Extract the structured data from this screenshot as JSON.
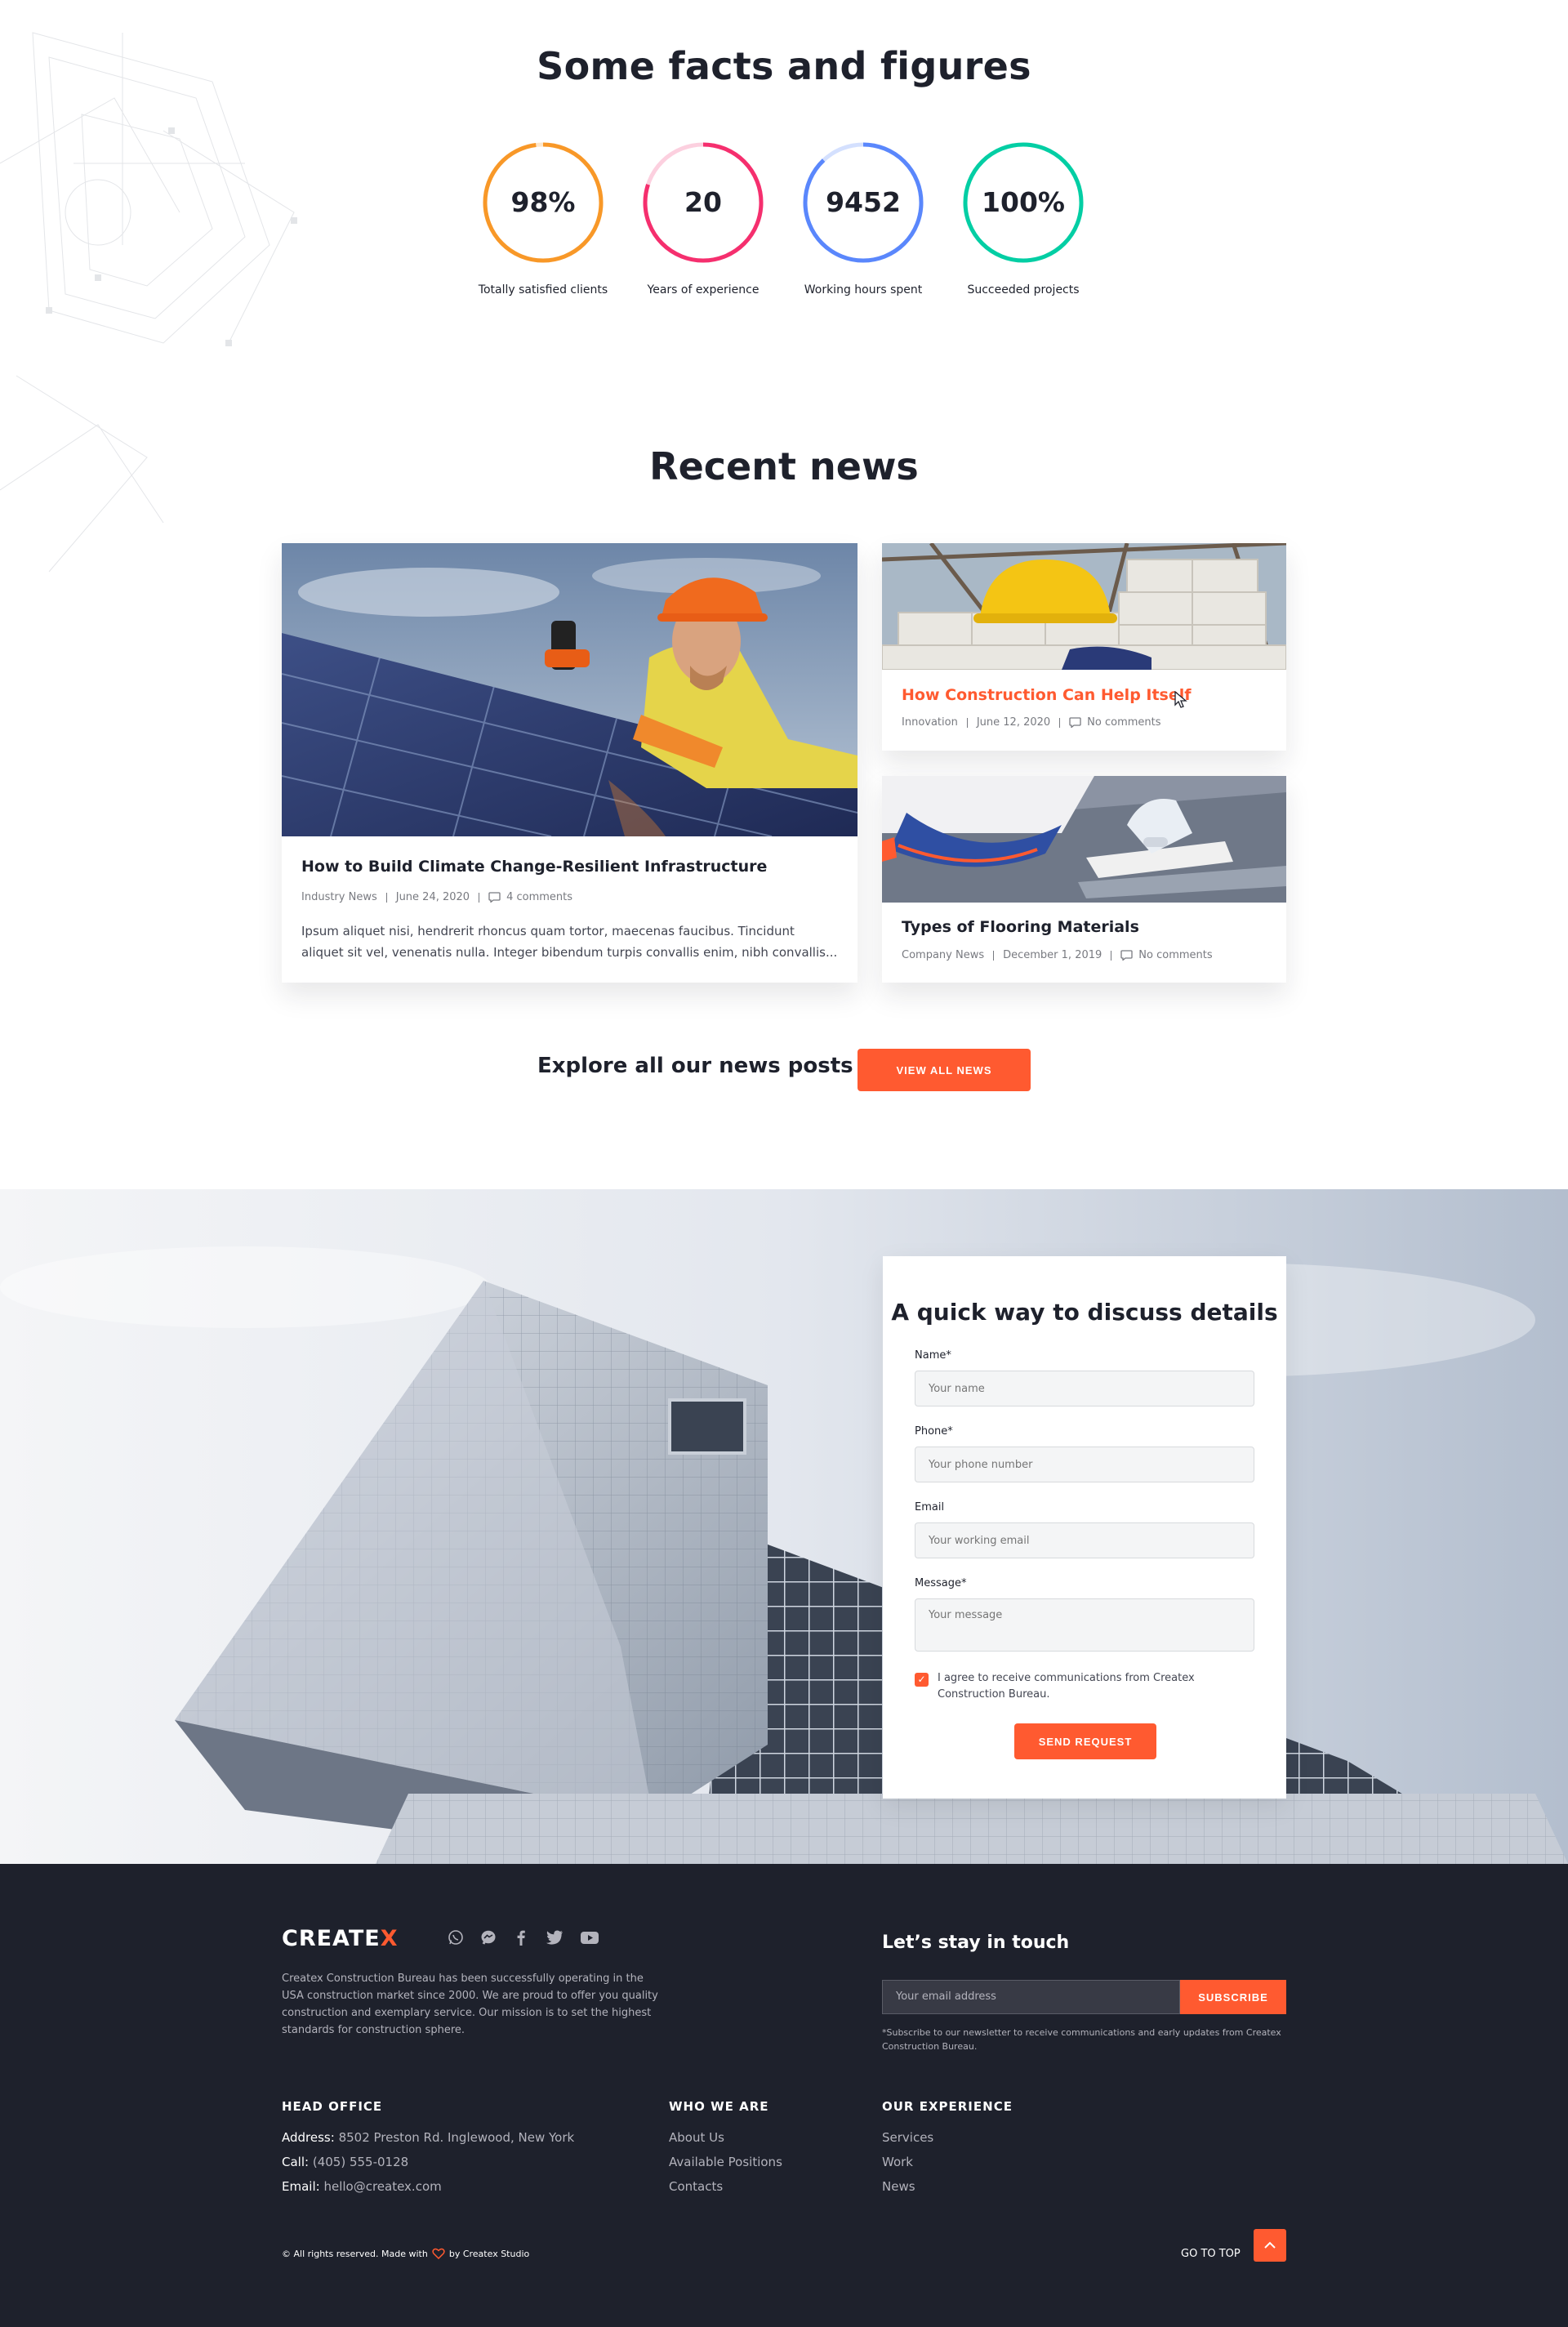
{
  "facts": {
    "title": "Some facts and figures",
    "stats": [
      {
        "value": "98%",
        "label": "Totally satisfied clients",
        "progress": 0.98,
        "color": "#f89828",
        "track": "#fde7cc"
      },
      {
        "value": "20",
        "label": "Years of experience",
        "progress": 0.8,
        "color": "#f52f6e",
        "track": "#fcd0df"
      },
      {
        "value": "9452",
        "label": "Working hours spent",
        "progress": 0.88,
        "color": "#5a87fc",
        "track": "#d4e0fe"
      },
      {
        "value": "100%",
        "label": "Succeeded projects",
        "progress": 1.0,
        "color": "#03cea4",
        "track": "#c8f3ea"
      }
    ]
  },
  "news": {
    "title": "Recent news",
    "featured": {
      "title": "How to Build Climate Change-Resilient Infrastructure",
      "category": "Industry News",
      "date": "June 24, 2020",
      "comments": "4 comments",
      "excerpt": "Ipsum aliquet nisi, hendrerit rhoncus quam tortor, maecenas faucibus. Tincidunt aliquet sit vel, venenatis nulla. Integer bibendum turpis convallis enim, nibh convallis..."
    },
    "side": [
      {
        "title": "How Construction Can Help Itself",
        "category": "Innovation",
        "date": "June 12, 2020",
        "comments": "No comments"
      },
      {
        "title": "Types of Flooring Materials",
        "category": "Company News",
        "date": "December 1, 2019",
        "comments": "No comments"
      }
    ],
    "explore_text": "Explore all our news posts",
    "view_all_label": "VIEW ALL NEWS"
  },
  "contact": {
    "title": "A quick way to discuss details",
    "name_label": "Name*",
    "name_placeholder": "Your name",
    "phone_label": "Phone*",
    "phone_placeholder": "Your phone number",
    "email_label": "Email",
    "email_placeholder": "Your working email",
    "message_label": "Message*",
    "message_placeholder": "Your message",
    "consent_text": "I agree to receive communications from Createx Construction Bureau.",
    "consent_checked": true,
    "submit_label": "SEND REQUEST"
  },
  "footer": {
    "logo_text": "CREATE",
    "logo_accent": "X",
    "description": "Createx Construction Bureau has been successfully operating in the USA construction market since 2000. We are proud to offer you quality construction and exemplary service. Our mission is to set the highest standards for construction sphere.",
    "social_icons": [
      "whatsapp-icon",
      "messenger-icon",
      "facebook-icon",
      "twitter-icon",
      "youtube-icon"
    ],
    "newsletter_title": "Let’s stay in touch",
    "newsletter_placeholder": "Your email address",
    "subscribe_label": "SUBSCRIBE",
    "newsletter_note": "*Subscribe to our newsletter to receive communications and early updates from Createx Construction Bureau.",
    "head_office": {
      "heading": "HEAD OFFICE",
      "address_label": "Address:",
      "address": "8502 Preston Rd. Inglewood, New York",
      "call_label": "Call:",
      "call": "(405) 555-0128",
      "email_label": "Email:",
      "email": "hello@createx.com"
    },
    "who_we_are": {
      "heading": "WHO WE ARE",
      "links": [
        "About Us",
        "Available Positions",
        "Contacts"
      ]
    },
    "our_experience": {
      "heading": "OUR EXPERIENCE",
      "links": [
        "Services",
        "Work",
        "News"
      ]
    },
    "copyright_pre": "© All rights reserved. Made with",
    "copyright_post": "by Createx Studio",
    "go_to_top": "GO TO TOP"
  },
  "colors": {
    "accent": "#ff5a30",
    "dark": "#1e212c"
  }
}
